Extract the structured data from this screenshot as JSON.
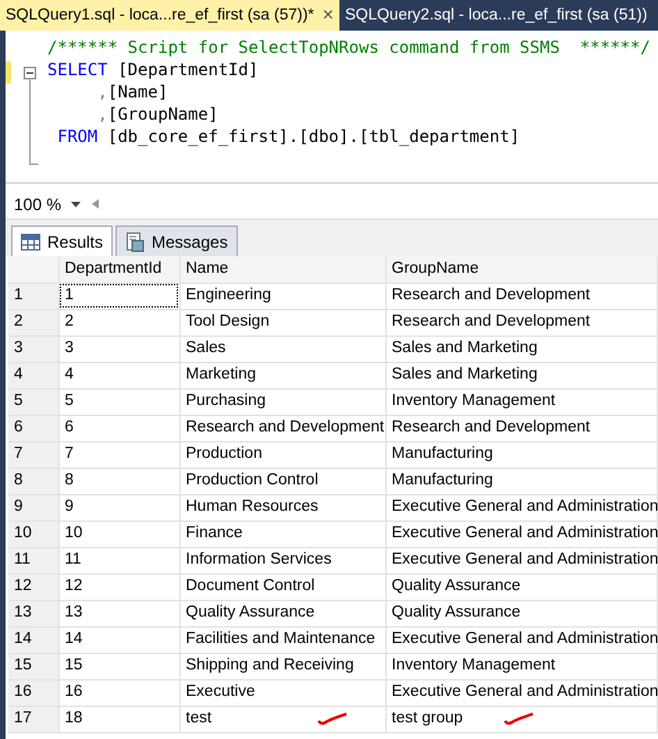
{
  "doc_tabs": [
    {
      "label": "SQLQuery1.sql - loca...re_ef_first (sa (57))*",
      "selected": true,
      "close": "×"
    },
    {
      "label": "SQLQuery2.sql - loca...re_ef_first (sa (51))",
      "selected": false
    }
  ],
  "editor": {
    "lines": [
      {
        "tokens": [
          {
            "text": "/****** Script for SelectTopNRows command from SSMS  ******/",
            "kind": "comment"
          }
        ]
      },
      {
        "fold": true,
        "tokens": [
          {
            "text": "SELECT",
            "kind": "keyword"
          },
          {
            "text": " [DepartmentId]",
            "kind": "plain"
          }
        ]
      },
      {
        "tokens": [
          {
            "text": "     ,",
            "kind": "punct"
          },
          {
            "text": "[Name]",
            "kind": "plain"
          }
        ]
      },
      {
        "tokens": [
          {
            "text": "     ,",
            "kind": "punct"
          },
          {
            "text": "[GroupName]",
            "kind": "plain"
          }
        ]
      },
      {
        "tokens": [
          {
            "text": " FROM",
            "kind": "keyword"
          },
          {
            "text": " [db_core_ef_first].[dbo].[tbl_department]",
            "kind": "plain"
          }
        ]
      }
    ]
  },
  "zoom": {
    "value": "100 %"
  },
  "result_tabs": [
    {
      "label": "Results",
      "selected": true
    },
    {
      "label": "Messages",
      "selected": false
    }
  ],
  "table": {
    "columns": [
      "DepartmentId",
      "Name",
      "GroupName"
    ],
    "rows": [
      {
        "num": "1",
        "cells": [
          "1",
          "Engineering",
          "Research and Development"
        ],
        "focused": true,
        "ticked": false
      },
      {
        "num": "2",
        "cells": [
          "2",
          "Tool Design",
          "Research and Development"
        ],
        "focused": false,
        "ticked": false
      },
      {
        "num": "3",
        "cells": [
          "3",
          "Sales",
          "Sales and Marketing"
        ],
        "focused": false,
        "ticked": false
      },
      {
        "num": "4",
        "cells": [
          "4",
          "Marketing",
          "Sales and Marketing"
        ],
        "focused": false,
        "ticked": false
      },
      {
        "num": "5",
        "cells": [
          "5",
          "Purchasing",
          "Inventory Management"
        ],
        "focused": false,
        "ticked": false
      },
      {
        "num": "6",
        "cells": [
          "6",
          "Research and Development",
          "Research and Development"
        ],
        "focused": false,
        "ticked": false
      },
      {
        "num": "7",
        "cells": [
          "7",
          "Production",
          "Manufacturing"
        ],
        "focused": false,
        "ticked": false
      },
      {
        "num": "8",
        "cells": [
          "8",
          "Production Control",
          "Manufacturing"
        ],
        "focused": false,
        "ticked": false
      },
      {
        "num": "9",
        "cells": [
          "9",
          "Human Resources",
          "Executive General and Administration"
        ],
        "focused": false,
        "ticked": false
      },
      {
        "num": "10",
        "cells": [
          "10",
          "Finance",
          "Executive General and Administration"
        ],
        "focused": false,
        "ticked": false
      },
      {
        "num": "11",
        "cells": [
          "11",
          "Information Services",
          "Executive General and Administration"
        ],
        "focused": false,
        "ticked": false
      },
      {
        "num": "12",
        "cells": [
          "12",
          "Document Control",
          "Quality Assurance"
        ],
        "focused": false,
        "ticked": false
      },
      {
        "num": "13",
        "cells": [
          "13",
          "Quality Assurance",
          "Quality Assurance"
        ],
        "focused": false,
        "ticked": false
      },
      {
        "num": "14",
        "cells": [
          "14",
          "Facilities and Maintenance",
          "Executive General and Administration"
        ],
        "focused": false,
        "ticked": false
      },
      {
        "num": "15",
        "cells": [
          "15",
          "Shipping and Receiving",
          "Inventory Management"
        ],
        "focused": false,
        "ticked": false
      },
      {
        "num": "16",
        "cells": [
          "16",
          "Executive",
          "Executive General and Administration"
        ],
        "focused": false,
        "ticked": false
      },
      {
        "num": "17",
        "cells": [
          "18",
          "test",
          "test group"
        ],
        "focused": false,
        "ticked": true
      }
    ]
  }
}
